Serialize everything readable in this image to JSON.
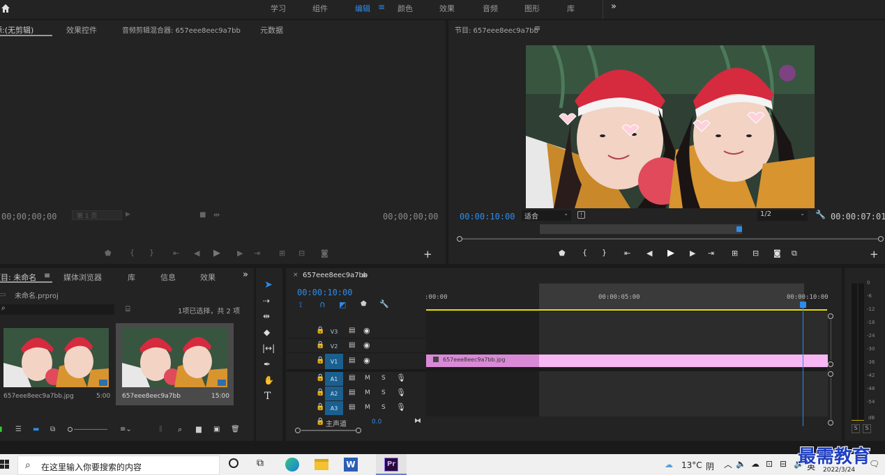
{
  "workspaces": [
    "学习",
    "组件",
    "编辑",
    "颜色",
    "效果",
    "音频",
    "图形",
    "库"
  ],
  "workspace_active": "编辑",
  "source": {
    "tabs": [
      "源:(无剪辑)",
      "效果控件",
      "音频剪辑混合器: 657eee8eec9a7bb",
      "元数据"
    ],
    "tc_left": "00;00;00;00",
    "tc_right": "00;00;00;00",
    "page_sel": "第 1 页"
  },
  "program": {
    "title": "节目: 657eee8eec9a7bb",
    "tc": "00:00:10:00",
    "fit": "适合",
    "res": "1/2",
    "dur": "00:00:07:01"
  },
  "project": {
    "tabs": [
      "项目: 未命名",
      "媒体浏览器",
      "库",
      "信息",
      "效果"
    ],
    "file": "未命名.prproj",
    "sel_info": "1项已选择，共 2 项",
    "items": [
      {
        "name": "657eee8eec9a7bb.jpg",
        "dur": "5:00"
      },
      {
        "name": "657eee8eec9a7bb",
        "dur": "15:00"
      }
    ]
  },
  "timeline": {
    "seq": "657eee8eec9a7bb",
    "tc": "00:00:10:00",
    "ruler": [
      ":00:00",
      "00:00:05:00",
      "00:00:10:00"
    ],
    "video": [
      "V3",
      "V2",
      "V1"
    ],
    "audio": [
      "A1",
      "A2",
      "A3"
    ],
    "m": "M",
    "s": "S",
    "master": "主声道",
    "master_val": "0.0",
    "clip": "657eee8eec9a7bb.jpg"
  },
  "meter": {
    "labels": [
      "0",
      "-6",
      "-12",
      "-18",
      "-24",
      "-30",
      "-36",
      "-42",
      "-48",
      "-54",
      "dB"
    ],
    "solo": [
      "S",
      "S"
    ]
  },
  "taskbar": {
    "search": "在这里输入你要搜索的内容",
    "temp": "13°C",
    "weather": "阴",
    "ime": "英",
    "date": "2022/3/24",
    "watermark": "最需教育"
  },
  "colors": {
    "accent": "#2d8ceb",
    "clip": "#f7b7f3",
    "clip_head": "#d98ad6",
    "playhead": "#2d8ceb",
    "yellow": "#e6e000"
  }
}
